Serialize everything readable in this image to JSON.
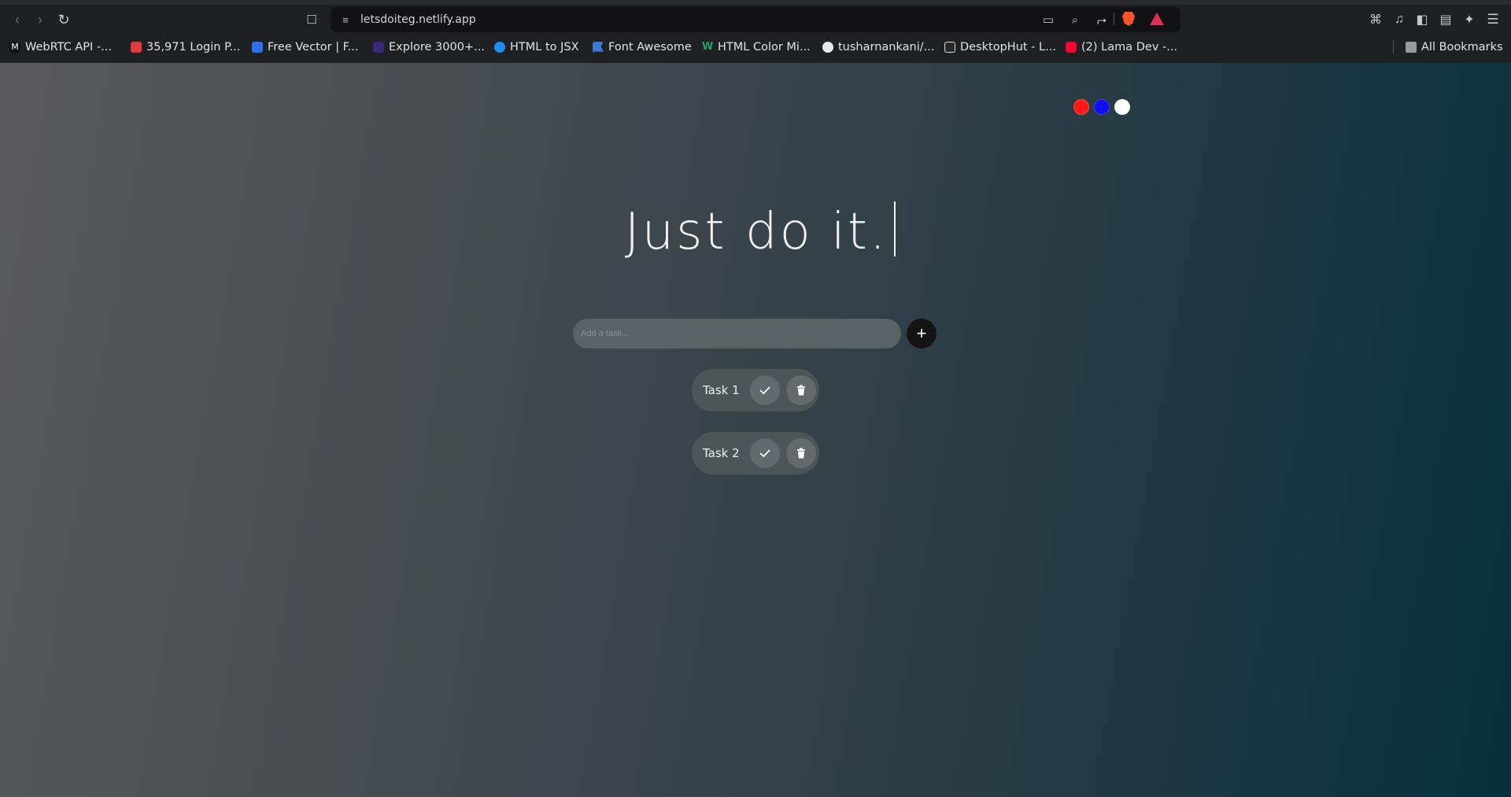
{
  "browser": {
    "url": "letsdoiteg.netlify.app",
    "bookmarks": [
      {
        "label": "WebRTC API -...",
        "icon": "webrtc-icon",
        "color": "#111111"
      },
      {
        "label": "35,971 Login P...",
        "icon": "freepik-icon",
        "color": "#e4393c"
      },
      {
        "label": "Free Vector | F...",
        "icon": "freepik-blue-icon",
        "color": "#2f6ff2"
      },
      {
        "label": "Explore 3000+...",
        "icon": "ui-icon",
        "color": "#3c2a78"
      },
      {
        "label": "HTML to JSX",
        "icon": "transform-icon",
        "color": "#1c8ff0"
      },
      {
        "label": "Font Awesome",
        "icon": "flag-icon",
        "color": "#3a7bd5"
      },
      {
        "label": "HTML Color Mi...",
        "icon": "w-icon",
        "color": "#18a36b"
      },
      {
        "label": "tusharnankani/...",
        "icon": "github-icon",
        "color": "#e8e8e8"
      },
      {
        "label": "DesktopHut - L...",
        "icon": "dh-icon",
        "color": "#dddddd"
      },
      {
        "label": "(2) Lama Dev -...",
        "icon": "youtube-icon",
        "color": "#ff0033"
      }
    ],
    "all_bookmarks": "All Bookmarks"
  },
  "app": {
    "title": "Just do it.",
    "input_placeholder": "Add a task...",
    "add_label": "+",
    "theme_colors": [
      "#ff1a1a",
      "#1010ee",
      "#ffffff"
    ],
    "tasks": [
      {
        "label": "Task 1"
      },
      {
        "label": "Task 2"
      }
    ]
  }
}
